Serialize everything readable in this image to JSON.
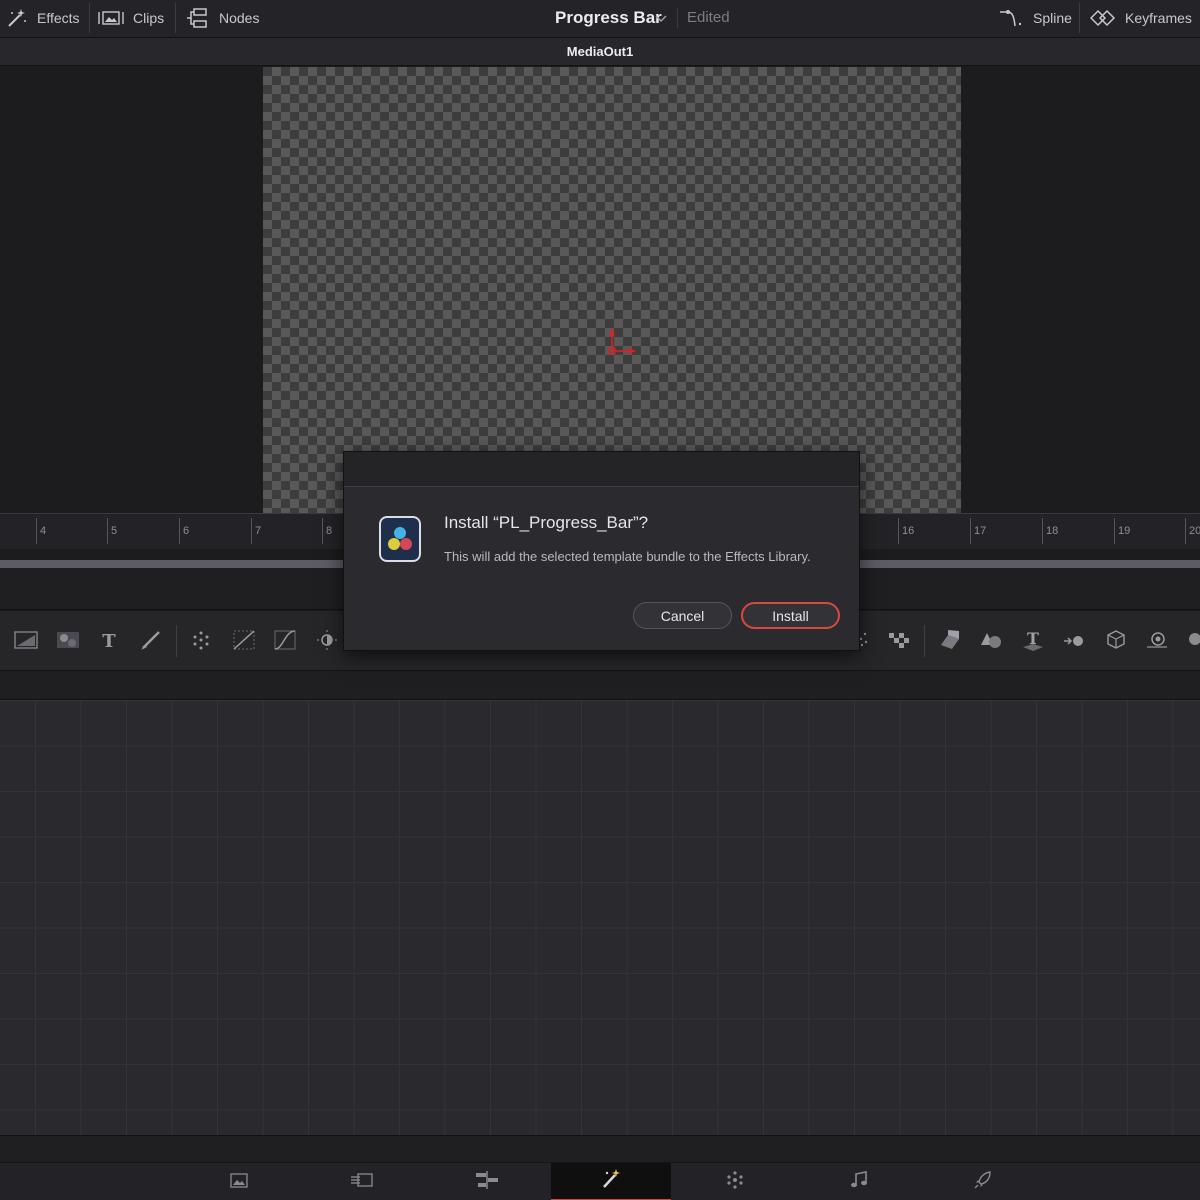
{
  "topbar": {
    "effects_label": "Effects",
    "clips_label": "Clips",
    "nodes_label": "Nodes",
    "project_title": "Progress Bar",
    "status": "Edited",
    "spline_label": "Spline",
    "keyframes_label": "Keyframes"
  },
  "viewer": {
    "node_name": "MediaOut1"
  },
  "ruler": {
    "ticks": [
      "4",
      "5",
      "6",
      "7",
      "8",
      "16",
      "17",
      "18",
      "19",
      "20"
    ]
  },
  "toolbar": {
    "tools": [
      "background-tool-icon",
      "fast-noise-icon",
      "text-plus-icon",
      "paint-icon",
      "particles-icon",
      "color-curves-icon",
      "curves-icon",
      "brightness-contrast-icon",
      "particle-emitter-icon",
      "checker-icon",
      "image-plane-3d-icon",
      "shape-3d-icon",
      "text-3d-icon",
      "merge-3d-icon",
      "camera-3d-icon",
      "renderer-3d-icon",
      "light-3d-icon"
    ]
  },
  "dialog": {
    "heading": "Install “PL_Progress_Bar”?",
    "message": "This will add the selected template bundle to the Effects Library.",
    "cancel_label": "Cancel",
    "install_label": "Install"
  },
  "pages": {
    "items": [
      "media-page-icon",
      "cut-page-icon",
      "edit-page-icon",
      "fusion-page-icon",
      "color-page-icon",
      "fairlight-page-icon",
      "deliver-page-icon"
    ],
    "active": "fusion-page-icon",
    "accent": "#e0403a"
  },
  "colors": {
    "install_border": "#d8483f",
    "gizmo": "#e02020"
  }
}
